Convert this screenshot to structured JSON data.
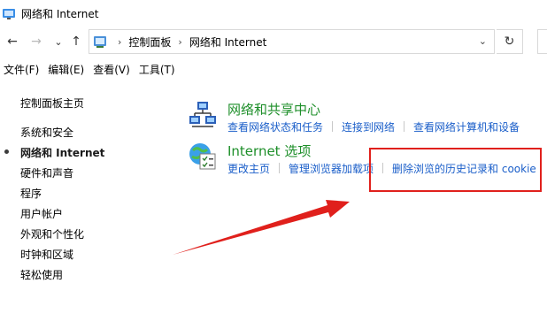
{
  "window": {
    "title": "网络和 Internet"
  },
  "nav": {
    "back_glyph": "←",
    "forward_glyph": "→",
    "recent_glyph": "⌄",
    "up_glyph": "↑",
    "refresh_glyph": "↻",
    "dropdown_glyph": "⌄"
  },
  "address": {
    "separator": "›",
    "crumbs": [
      "控制面板",
      "网络和 Internet"
    ]
  },
  "menubar": {
    "items": [
      "文件(F)",
      "编辑(E)",
      "查看(V)",
      "工具(T)"
    ]
  },
  "sidebar": {
    "items": [
      {
        "label": "控制面板主页",
        "current": false
      },
      {
        "label": "系统和安全",
        "current": false
      },
      {
        "label": "网络和 Internet",
        "current": true
      },
      {
        "label": "硬件和声音",
        "current": false
      },
      {
        "label": "程序",
        "current": false
      },
      {
        "label": "用户帐户",
        "current": false
      },
      {
        "label": "外观和个性化",
        "current": false
      },
      {
        "label": "时钟和区域",
        "current": false
      },
      {
        "label": "轻松使用",
        "current": false
      }
    ]
  },
  "main": {
    "sections": [
      {
        "title": "网络和共享中心",
        "icon": "network-sharing-center-icon",
        "links": [
          "查看网络状态和任务",
          "连接到网络",
          "查看网络计算机和设备"
        ]
      },
      {
        "title": "Internet 选项",
        "icon": "internet-options-icon",
        "links": [
          "更改主页",
          "管理浏览器加载项",
          "删除浏览的历史记录和 cookie"
        ]
      }
    ]
  },
  "colors": {
    "section_title": "#1e8f2a",
    "link": "#1a5ec9",
    "annotation": "#e0201c"
  }
}
